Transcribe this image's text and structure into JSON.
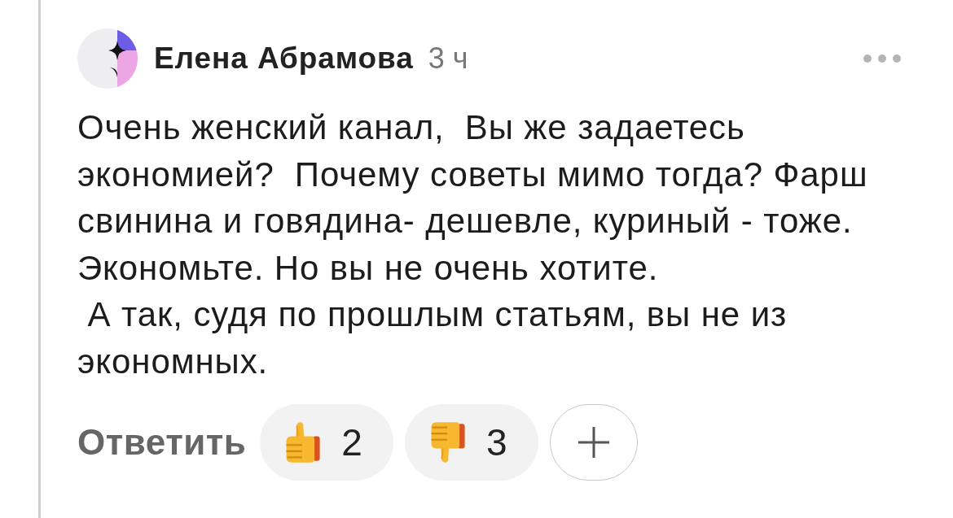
{
  "comment": {
    "author": "Елена Абрамова",
    "time": "3 ч",
    "paragraphs": [
      "Очень женский канал,  Вы же задаетесь экономией?  Почему советы мимо тогда? Фарш свинина и говядина- дешевле, куриный - тоже. Экономьте. Но вы не очень хотите.",
      " А так, судя по прошлым статьям, вы не из экономных."
    ],
    "reply_label": "Ответить",
    "reactions": [
      {
        "kind": "thumbs_up",
        "count": "2"
      },
      {
        "kind": "thumbs_down",
        "count": "3"
      }
    ]
  }
}
